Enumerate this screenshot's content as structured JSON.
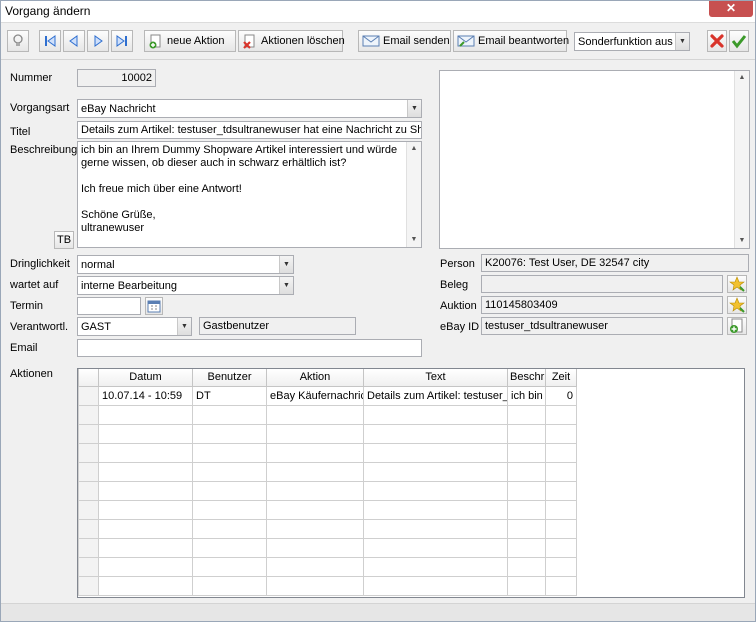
{
  "window": {
    "title": "Vorgang ändern",
    "close_symbol": "✕"
  },
  "toolbar": {
    "new_action": "neue Aktion",
    "delete_actions": "Aktionen löschen",
    "send_email": "Email senden",
    "reply_email": "Email beantworten",
    "special_function": "Sonderfunktion aus"
  },
  "form": {
    "nummer": {
      "label": "Nummer",
      "value": "10002"
    },
    "vorgangsart": {
      "label": "Vorgangsart",
      "value": "eBay Nachricht"
    },
    "titel": {
      "label": "Titel",
      "value": "Details zum Artikel: testuser_tdsultranewuser hat eine Nachricht zu Shop"
    },
    "beschreibung": {
      "label": "Beschreibung",
      "tb_label": "TB",
      "lines": [
        "ich bin an Ihrem Dummy Shopware Artikel interessiert und würde",
        "gerne wissen, ob dieser auch in schwarz erhältlich ist?",
        "",
        "Ich freue mich über eine Antwort!",
        "",
        "Schöne Grüße,",
        "ultranewuser"
      ]
    },
    "dringlichkeit": {
      "label": "Dringlichkeit",
      "value": "normal"
    },
    "wartet_auf": {
      "label": "wartet auf",
      "value": "interne Bearbeitung"
    },
    "termin": {
      "label": "Termin",
      "value": ""
    },
    "verantwortl": {
      "label": "Verantwortl.",
      "value": "GAST",
      "name": "Gastbenutzer"
    },
    "email": {
      "label": "Email",
      "value": ""
    },
    "aktionen_label": "Aktionen"
  },
  "right": {
    "person": {
      "label": "Person",
      "value": "K20076: Test User, DE 32547 city"
    },
    "beleg": {
      "label": "Beleg",
      "value": ""
    },
    "auktion": {
      "label": "Auktion",
      "value": "110145803409"
    },
    "ebay_id": {
      "label": "eBay ID",
      "value": "testuser_tdsultranewuser"
    }
  },
  "actions_table": {
    "columns": [
      "Datum",
      "Benutzer",
      "Aktion",
      "Text",
      "Beschr",
      "Zeit"
    ],
    "rows": [
      [
        "10.07.14 - 10:59",
        "DT",
        "eBay Käufernachric",
        "Details zum Artikel: testuser_t",
        "ich bin",
        "0"
      ]
    ]
  },
  "colors": {
    "delete_red": "#d9342b",
    "confirm_green": "#3c9a2a",
    "nav_blue": "#2f6fd0"
  }
}
